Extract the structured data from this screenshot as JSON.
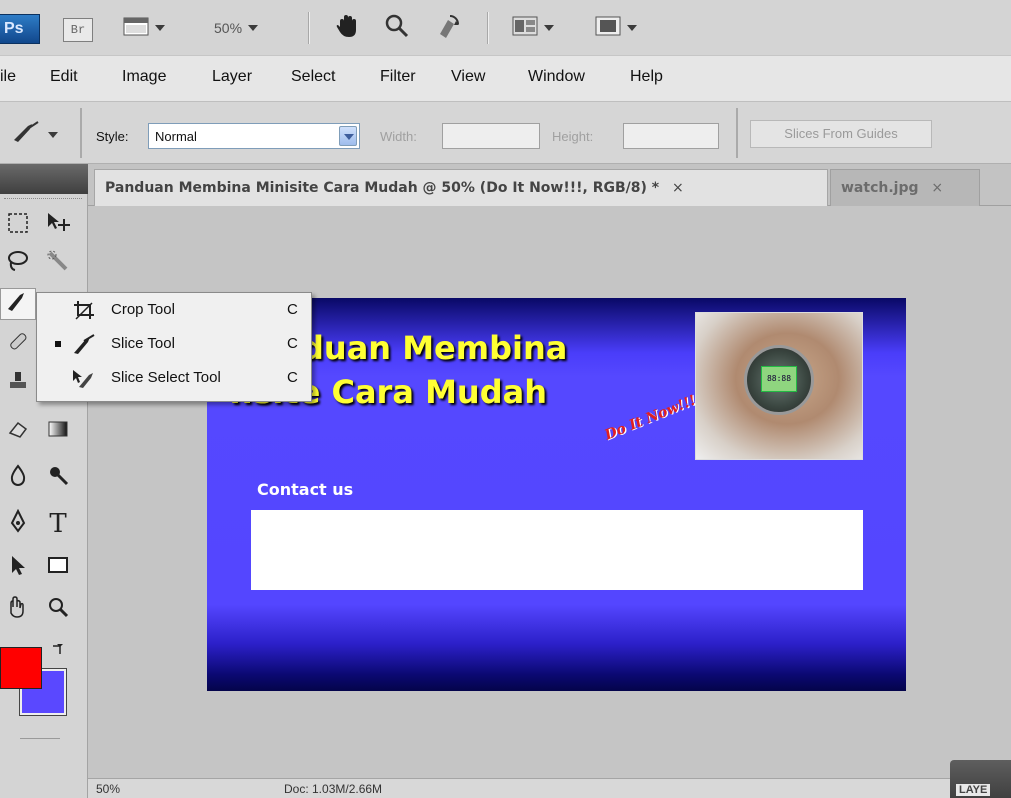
{
  "appbar": {
    "ps_label": "Ps",
    "br_label": "Br",
    "zoom": "50%",
    "icons": [
      "screen-mode-icon",
      "hand-icon",
      "zoom-icon",
      "rotate-view-icon",
      "arrange-documents-icon",
      "screen-layout-icon"
    ]
  },
  "menu": {
    "file": "ile",
    "edit": "Edit",
    "image": "Image",
    "layer": "Layer",
    "select": "Select",
    "filter": "Filter",
    "view": "View",
    "window": "Window",
    "help": "Help"
  },
  "options": {
    "style_label": "Style:",
    "style_value": "Normal",
    "width_label": "Width:",
    "height_label": "Height:",
    "slices_button": "Slices From Guides"
  },
  "tabs": {
    "active": "Panduan Membina Minisite Cara Mudah @ 50% (Do It Now!!!, RGB/8) *",
    "active_close": "×",
    "inactive": "watch.jpg",
    "inactive_close": "×"
  },
  "flyout": {
    "items": [
      {
        "label": "Crop Tool",
        "key": "C"
      },
      {
        "label": "Slice Tool",
        "key": "C"
      },
      {
        "label": "Slice Select Tool",
        "key": "C"
      }
    ]
  },
  "document": {
    "title_line1": "duan Membina",
    "title_line2": "..site Cara Mudah",
    "tagline": "Do It Now!!!",
    "contact": "Contact us",
    "watch_screen": "88:88"
  },
  "status": {
    "zoom": "50%",
    "doc_info": "Doc: 1.03M/2.66M"
  },
  "tools_panel": {
    "type_tool": "T"
  },
  "panels": {
    "layers": "LAYE"
  },
  "colors": {
    "foreground": "#ff0000",
    "background": "#5a48ff"
  }
}
